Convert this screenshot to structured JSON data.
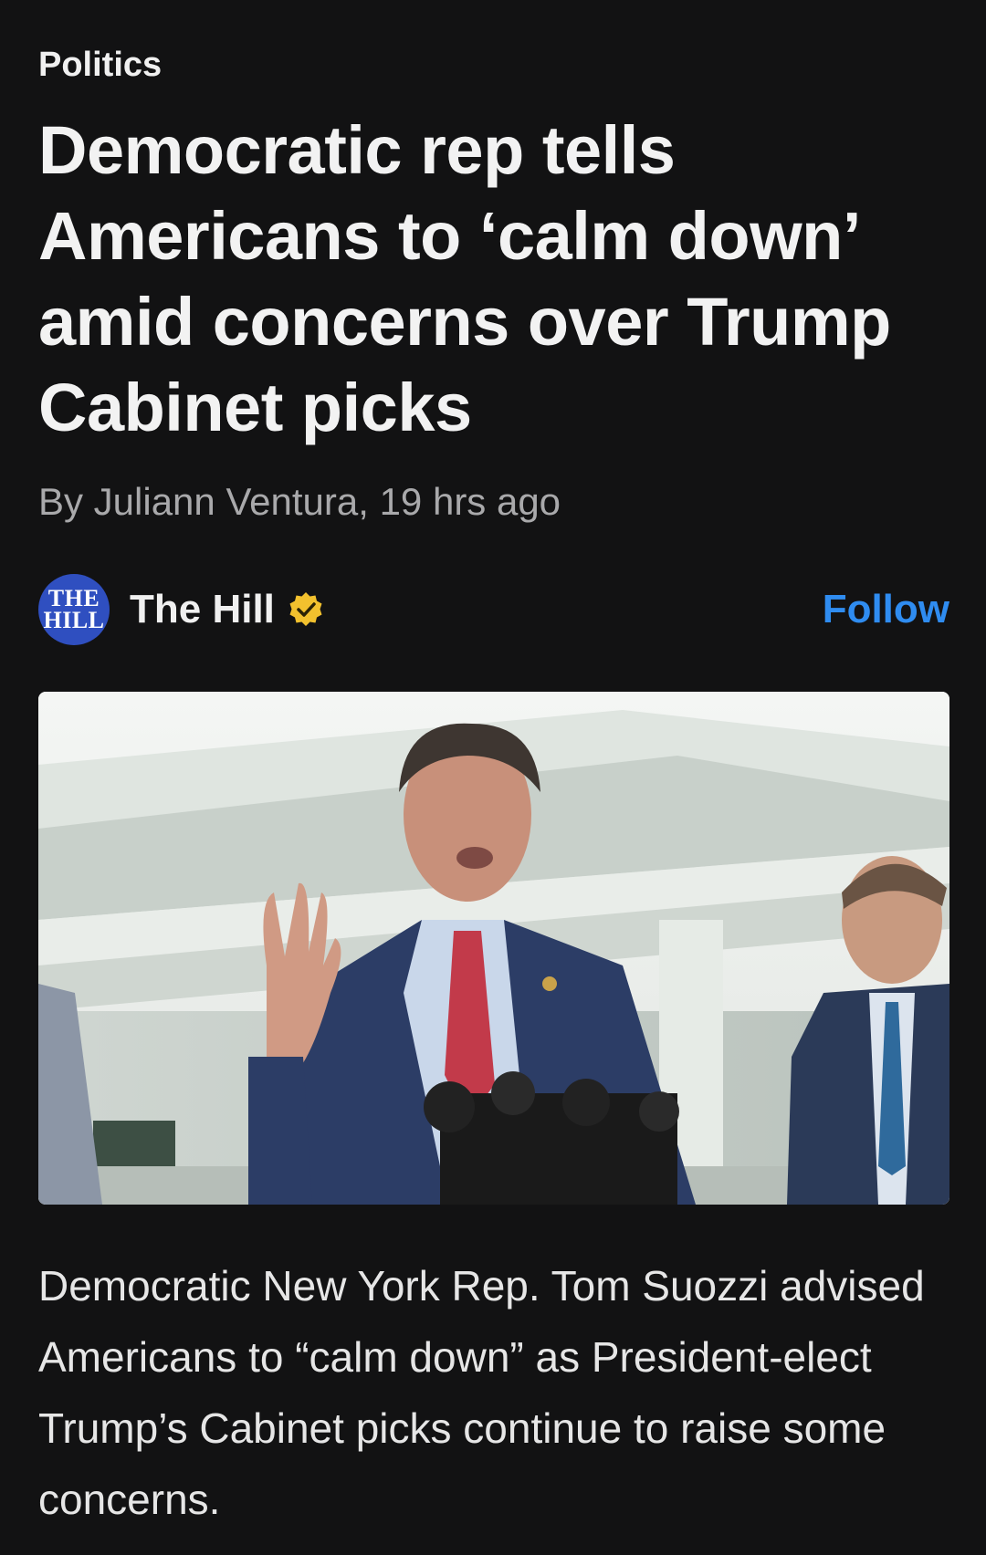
{
  "article": {
    "category": "Politics",
    "headline": "Democratic rep tells Americans to ‘calm down’ amid concerns over Trump Cabinet picks",
    "byline": "By Juliann Ventura, 19 hrs ago",
    "summary": "Democratic New York Rep. Tom Suozzi advised Americans to “calm down” as President-elect Trump’s Cabinet picks continue to raise some concerns."
  },
  "source": {
    "logo_line1": "THE",
    "logo_line2": "HILL",
    "name": "The Hill",
    "verified_icon": "verified-badge-icon",
    "follow_label": "Follow"
  },
  "colors": {
    "background": "#121213",
    "accent": "#2f8cf0",
    "verified": "#f2c12e",
    "logo_bg": "#2f4fc0"
  }
}
